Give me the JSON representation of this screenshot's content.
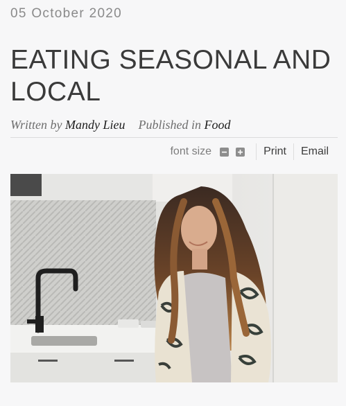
{
  "article": {
    "date": "05 October 2020",
    "title": "EATING SEASONAL AND LOCAL",
    "byline": {
      "written_by_label": "Written by",
      "author": "Mandy Lieu",
      "published_in_label": "Published in",
      "category": "Food"
    }
  },
  "toolbar": {
    "font_size_label": "font size",
    "decrease_icon": "minus-icon",
    "increase_icon": "plus-icon",
    "print_label": "Print",
    "email_label": "Email"
  },
  "image": {
    "subject": "woman-in-kitchen-photo"
  }
}
